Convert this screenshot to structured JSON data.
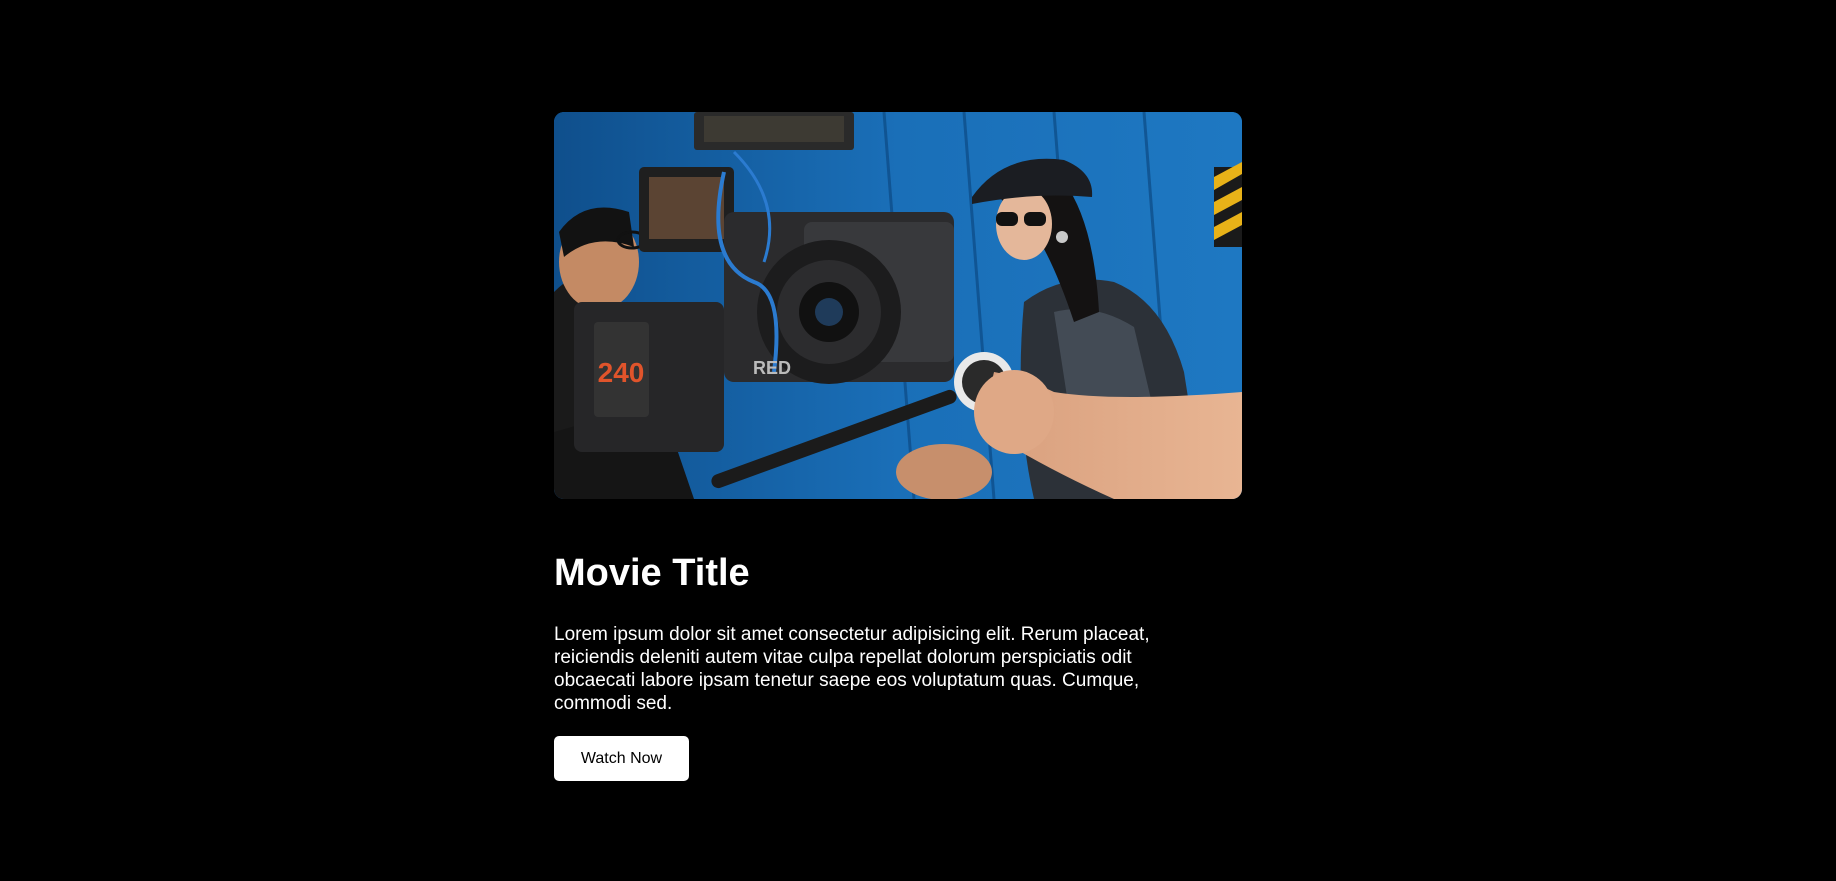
{
  "movie": {
    "title": "Movie Title",
    "description": "Lorem ipsum dolor sit amet consectetur adipisicing elit. Rerum placeat, reiciendis deleniti autem vitae culpa repellat dolorum perspiciatis odit obcaecati labore ipsam tenetur saepe eos voluptatum quas. Cumque, commodi sed.",
    "cta_label": "Watch Now"
  },
  "hero_image": {
    "subject": "film crew operating a cinema camera in front of a blue wall with a woman in sunglasses and cap",
    "battery_label": "240",
    "brand_label": "RED"
  },
  "colors": {
    "background": "#000000",
    "text": "#ffffff",
    "button_bg": "#ffffff",
    "button_text": "#000000",
    "wall_blue": "#1d6db0"
  }
}
